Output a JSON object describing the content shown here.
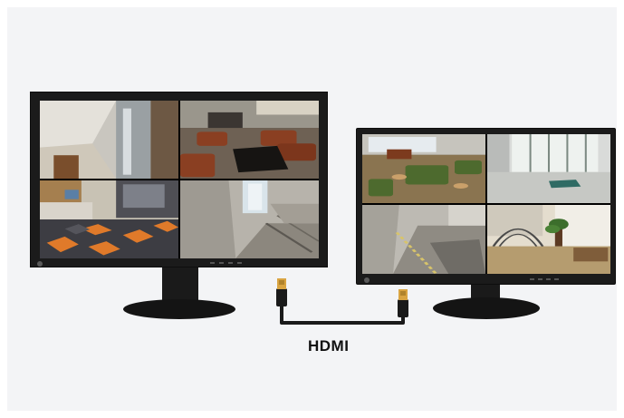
{
  "connector_label": "HDMI",
  "colors": {
    "background": "#f3f4f6",
    "bezel": "#1b1b1b",
    "cable": "#1a1a1a",
    "connector_gold": "#d9a441",
    "sofa_brown": "#8a3f22",
    "carpet_orange": "#e07a2a",
    "sofa_green": "#4d6a2e"
  },
  "left_monitor": {
    "feeds": [
      {
        "scene": "corridor-room"
      },
      {
        "scene": "lounge-brown-sofas"
      },
      {
        "scene": "office-lobby-orange-carpet"
      },
      {
        "scene": "stairwell"
      }
    ]
  },
  "right_monitor": {
    "feeds": [
      {
        "scene": "lobby-green-sofas"
      },
      {
        "scene": "glass-door-entrance"
      },
      {
        "scene": "stair-landing"
      },
      {
        "scene": "bright-room-plant"
      }
    ]
  }
}
